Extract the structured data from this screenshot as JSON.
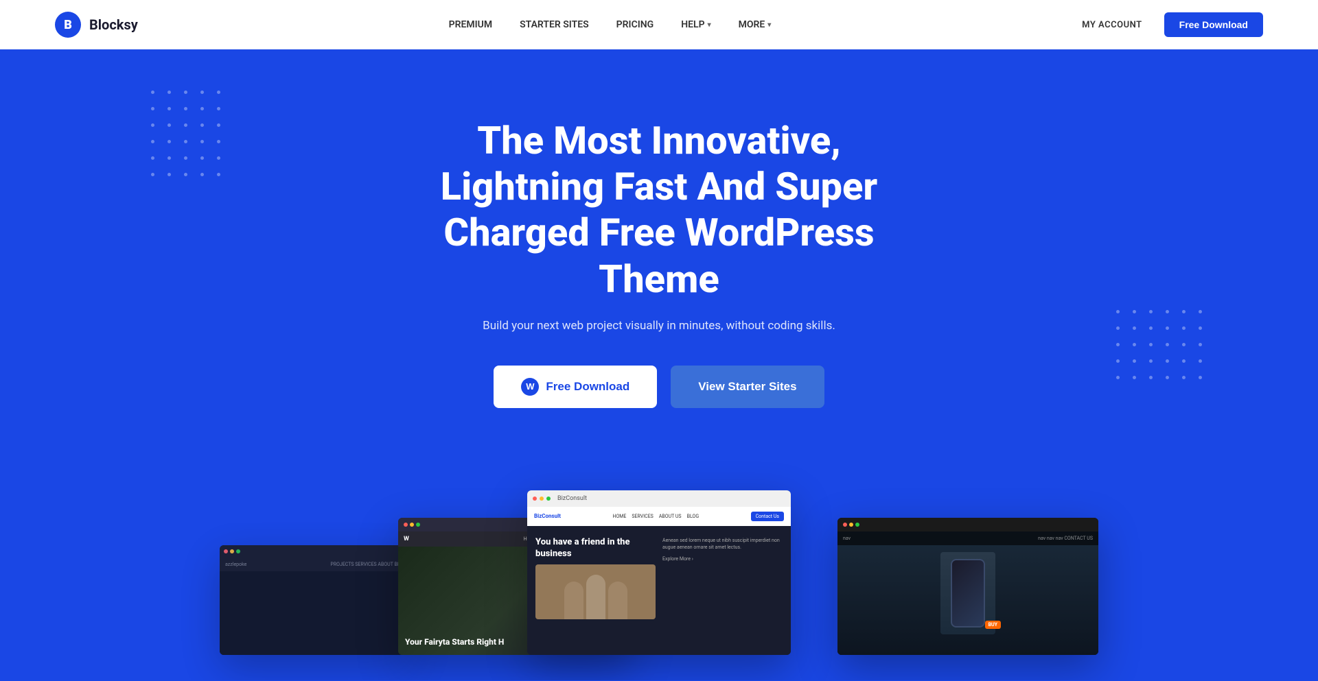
{
  "navbar": {
    "logo_letter": "B",
    "brand_name": "Blocksy",
    "nav_items": [
      {
        "id": "premium",
        "label": "PREMIUM",
        "has_dropdown": false
      },
      {
        "id": "starter-sites",
        "label": "STARTER SITES",
        "has_dropdown": false
      },
      {
        "id": "pricing",
        "label": "PRICING",
        "has_dropdown": false
      },
      {
        "id": "help",
        "label": "HELP",
        "has_dropdown": true
      },
      {
        "id": "more",
        "label": "MORE",
        "has_dropdown": true
      }
    ],
    "my_account_label": "MY ACCOUNT",
    "cta_label": "Free Download"
  },
  "hero": {
    "title": "The Most Innovative, Lightning Fast And Super Charged Free WordPress Theme",
    "subtitle": "Build your next web project visually in minutes, without coding skills.",
    "cta_primary": "Free Download",
    "cta_secondary": "View Starter Sites"
  },
  "screenshots": {
    "center": {
      "site_label": "BizConsult",
      "nav_links": [
        "HOME",
        "SERVICES",
        "ABOUT US",
        "BLOG"
      ],
      "nav_btn": "Contact Us",
      "headline": "You have a friend in the business"
    },
    "left": {
      "headline": "Your Fairyta Starts Right H"
    },
    "far_left": {
      "brand": "azzlepoke"
    },
    "right": {
      "price_label": "BUY"
    }
  },
  "colors": {
    "primary": "#1a47e5",
    "white": "#ffffff",
    "teal_btn": "#3a6fd8"
  }
}
